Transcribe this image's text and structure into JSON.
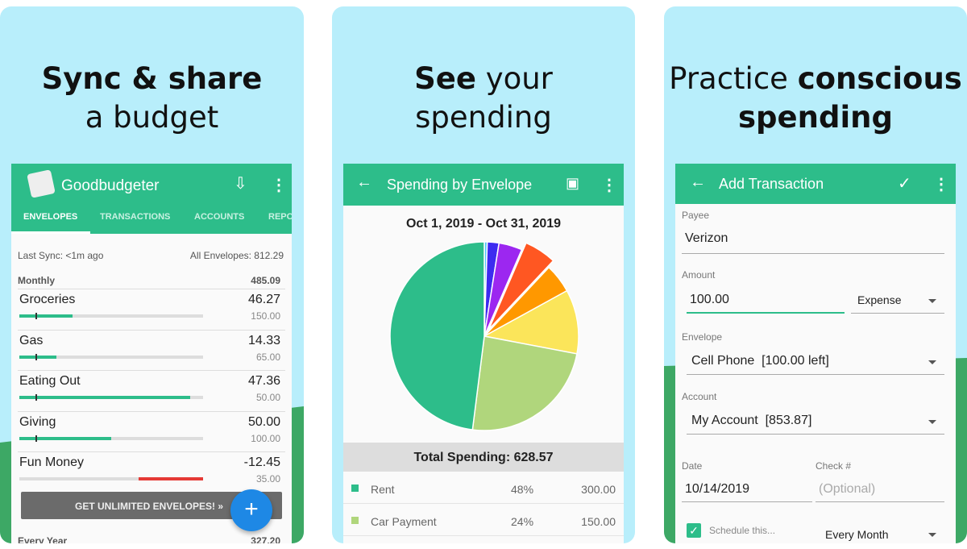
{
  "panels": [
    {
      "headline_1": "Sync & share",
      "headline_2": "a budget"
    },
    {
      "headline_1_bold": "See",
      "headline_1_rest": " your",
      "headline_2": "spending"
    },
    {
      "headline_1": "Practice ",
      "headline_1_bold": "conscious",
      "headline_2": "spending"
    }
  ],
  "app1": {
    "title": "Goodbudgeter",
    "tabs": [
      "ENVELOPES",
      "TRANSACTIONS",
      "ACCOUNTS",
      "REPO"
    ],
    "last_sync": "Last Sync: <1m ago",
    "all_envelopes": "All Envelopes: 812.29",
    "group_monthly": {
      "label": "Monthly",
      "total": "485.09"
    },
    "envelopes": [
      {
        "name": "Groceries",
        "amount": "46.27",
        "budget": "150.00",
        "progress": 0.29,
        "over": false
      },
      {
        "name": "Gas",
        "amount": "14.33",
        "budget": "65.00",
        "progress": 0.2,
        "over": false
      },
      {
        "name": "Eating Out",
        "amount": "47.36",
        "budget": "50.00",
        "progress": 0.93,
        "over": false
      },
      {
        "name": "Giving",
        "amount": "50.00",
        "budget": "100.00",
        "progress": 0.5,
        "over": false
      },
      {
        "name": "Fun Money",
        "amount": "-12.45",
        "budget": "35.00",
        "progress": 0.35,
        "over": true
      }
    ],
    "upgrade_button": "GET UNLIMITED ENVELOPES! »",
    "fab": "+",
    "group_yearly": {
      "label": "Every Year",
      "total": "327.20"
    }
  },
  "app2": {
    "title": "Spending by Envelope",
    "date_range": "Oct 1, 2019 - Oct 31, 2019",
    "total": "Total Spending: 628.57",
    "legend": [
      {
        "name": "Rent",
        "pct": "48%",
        "amount": "300.00",
        "color": "#2dbd8a"
      },
      {
        "name": "Car Payment",
        "pct": "24%",
        "amount": "150.00",
        "color": "#b0d67c"
      }
    ]
  },
  "chart_data": {
    "type": "pie",
    "title": "Oct 1, 2019 - Oct 31, 2019",
    "slices": [
      {
        "name": "Rent",
        "value": 48,
        "color": "#2dbd8a"
      },
      {
        "name": "Car Payment",
        "value": 24,
        "color": "#b0d67c"
      },
      {
        "value": 11,
        "color": "#fbe55a"
      },
      {
        "value": 5,
        "color": "#ff9800"
      },
      {
        "value": 5.5,
        "color": "#ff5722",
        "exploded": true
      },
      {
        "value": 4,
        "color": "#9c27f0"
      },
      {
        "value": 2,
        "color": "#3d2bf0"
      },
      {
        "value": 0.5,
        "color": "#4fc3f7"
      }
    ]
  },
  "app3": {
    "title": "Add Transaction",
    "payee_label": "Payee",
    "payee": "Verizon",
    "amount_label": "Amount",
    "amount": "100.00",
    "type": "Expense",
    "envelope_label": "Envelope",
    "envelope": "Cell Phone  [100.00 left]",
    "account_label": "Account",
    "account": "My Account  [853.87]",
    "date_label": "Date",
    "date": "10/14/2019",
    "check_label": "Check #",
    "check_placeholder": "(Optional)",
    "schedule_label": "Schedule this...",
    "schedule_checked": true,
    "frequency": "Every Month"
  }
}
